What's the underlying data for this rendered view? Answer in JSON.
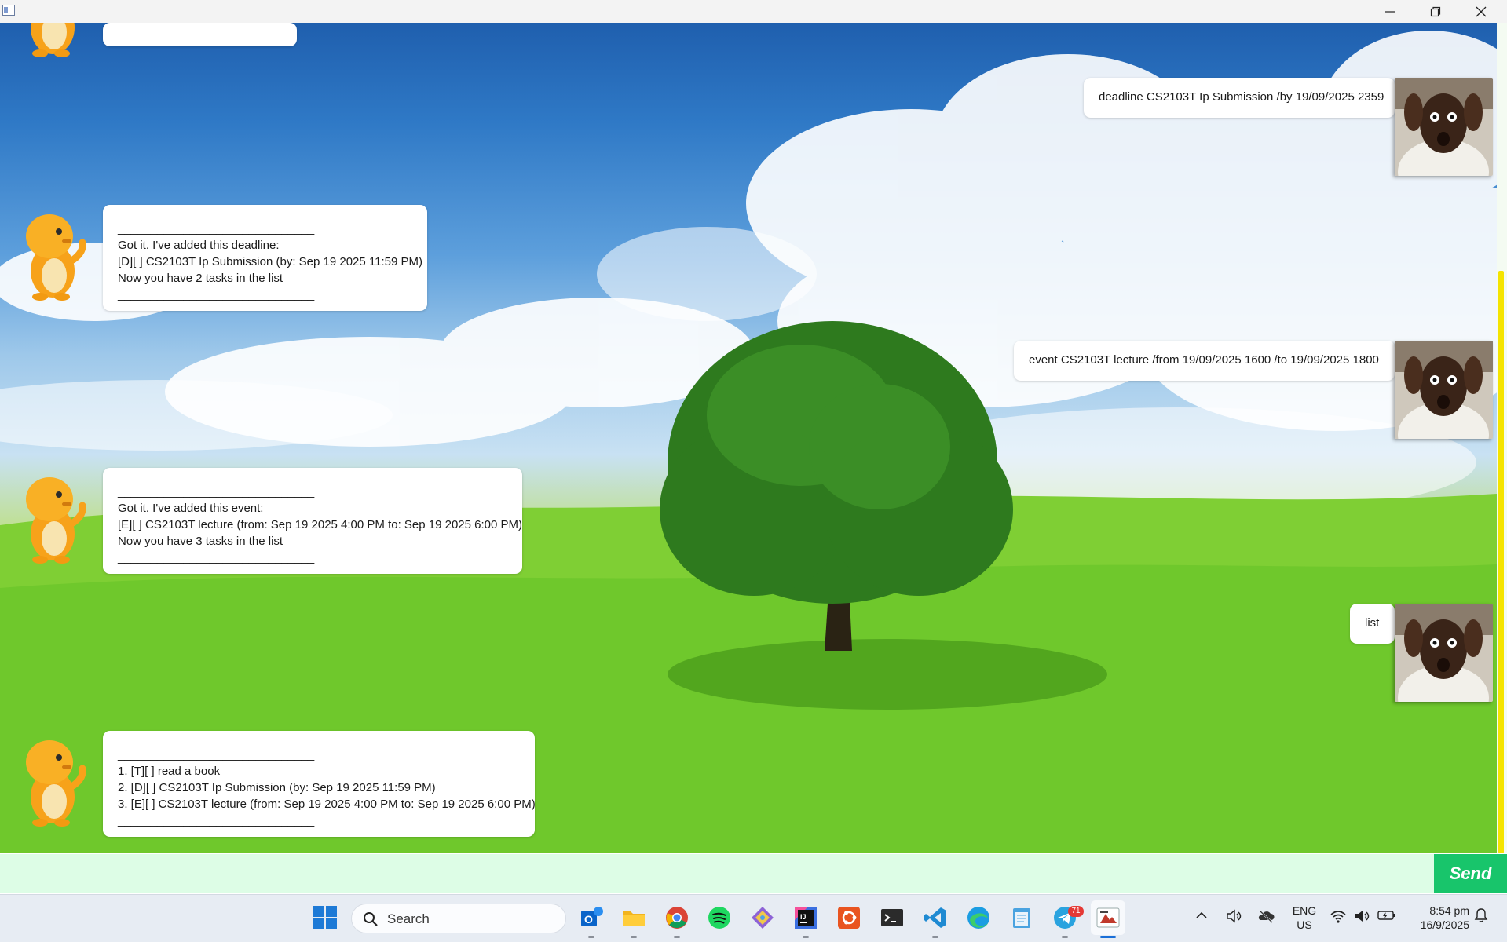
{
  "window": {
    "controls": {
      "minimize_icon": "minimize-icon",
      "maximize_icon": "restore-icon",
      "close_icon": "close-icon"
    }
  },
  "chat": {
    "messages": [
      {
        "sender": "duke",
        "lines": [
          "______________________________"
        ]
      },
      {
        "sender": "user",
        "text": "deadline CS2103T Ip Submission /by 19/09/2025 2359"
      },
      {
        "sender": "duke",
        "lines": [
          "______________________________",
          "Got it. I've added this deadline:",
          "[D][ ] CS2103T Ip Submission (by: Sep 19 2025 11:59 PM)",
          "Now you have 2 tasks in the list",
          "______________________________"
        ]
      },
      {
        "sender": "user",
        "text": "event CS2103T lecture /from 19/09/2025 1600 /to 19/09/2025 1800"
      },
      {
        "sender": "duke",
        "lines": [
          "______________________________",
          "Got it. I've added this event:",
          "[E][ ] CS2103T lecture (from: Sep 19 2025 4:00 PM to: Sep 19 2025 6:00 PM)",
          "Now you have 3 tasks in the list",
          "______________________________"
        ]
      },
      {
        "sender": "user",
        "text": "list"
      },
      {
        "sender": "duke",
        "lines": [
          "______________________________",
          "1. [T][ ] read a book",
          "2. [D][ ] CS2103T Ip Submission (by: Sep 19 2025 11:59 PM)",
          "3. [E][ ] CS2103T lecture (from: Sep 19 2025 4:00 PM to: Sep 19 2025 6:00 PM)",
          "______________________________"
        ]
      }
    ]
  },
  "input": {
    "value": "",
    "placeholder": ""
  },
  "send_button": {
    "label": "Send",
    "color": "#18c56b"
  },
  "colors": {
    "input_bg": "#ddfde6",
    "scroll_thumb": "#f5e400",
    "taskbar_bg": "#e7ecf3"
  },
  "taskbar": {
    "search_label": "Search",
    "apps": [
      "outlook-icon",
      "file-explorer-icon",
      "chrome-icon",
      "spotify-icon",
      "git-tool-icon",
      "intellij-icon",
      "ubuntu-icon",
      "terminal-icon",
      "vscode-icon",
      "edge-icon",
      "notepad-icon",
      "telegram-icon",
      "java-app-icon"
    ],
    "telegram_badge": "71",
    "tray": {
      "lang_line1": "ENG",
      "lang_line2": "US",
      "time": "8:54 pm",
      "date": "16/9/2025"
    }
  }
}
